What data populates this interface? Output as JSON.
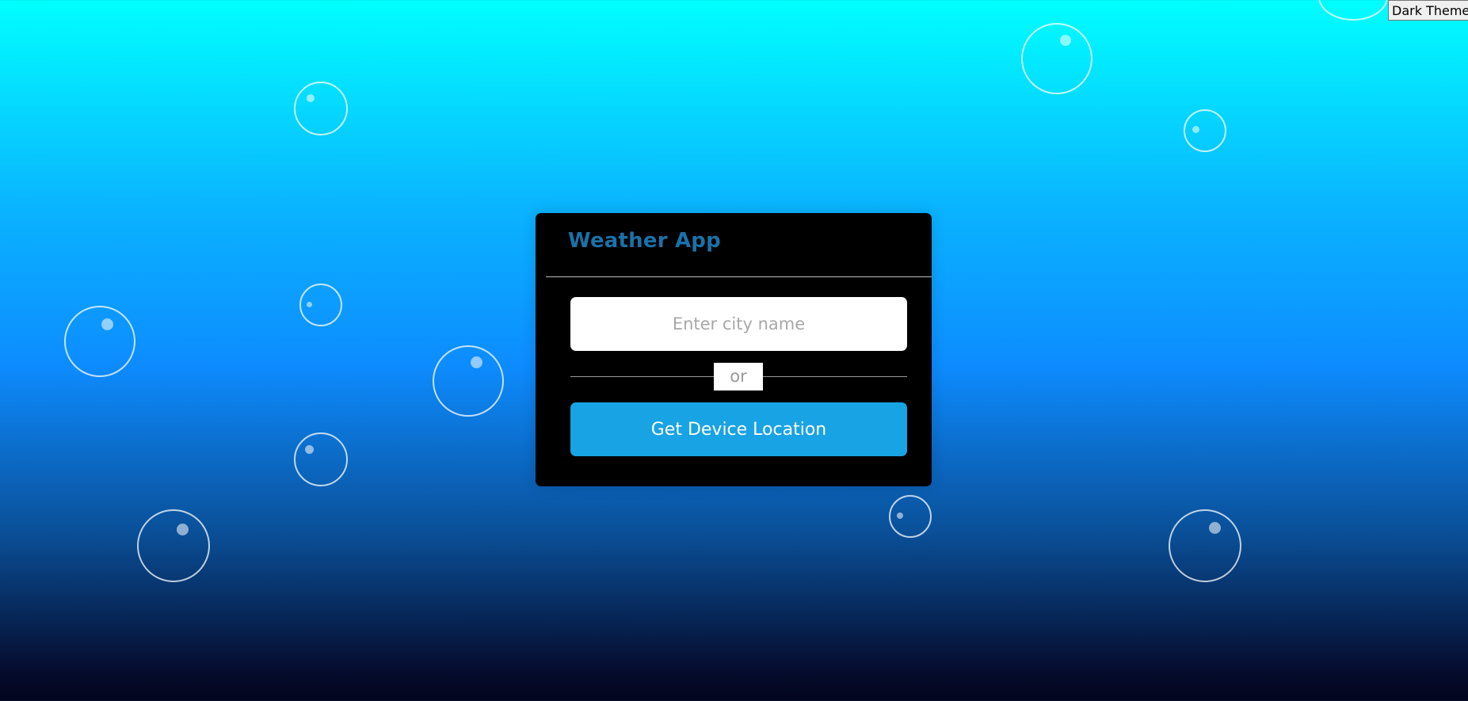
{
  "theme_toggle": {
    "label": "Dark Theme"
  },
  "card": {
    "title": "Weather App",
    "city_input": {
      "placeholder": "Enter city name",
      "value": ""
    },
    "separator_text": "or",
    "location_button_label": "Get Device Location"
  },
  "colors": {
    "title": "#1b71a8",
    "card_background": "#000000",
    "button_background": "#18a3e4",
    "gradient_top": "#00ffff",
    "gradient_bottom": "#02051c"
  }
}
